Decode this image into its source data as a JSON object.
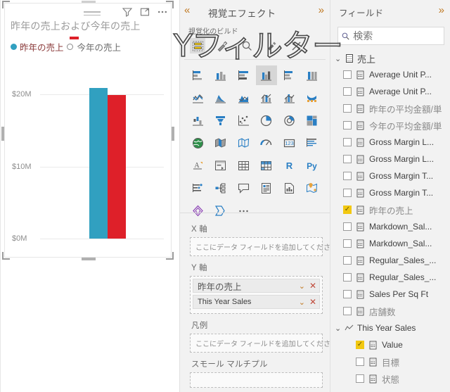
{
  "visual": {
    "title": "昨年の売上および今年の売上",
    "legend": [
      {
        "label": "昨年の売上",
        "color": "#31A0C0",
        "marker": "dot"
      },
      {
        "label": "今年の売上",
        "color": "#DE2029",
        "marker": "circle-outline"
      }
    ],
    "header_icons": [
      {
        "name": "filter-icon",
        "glyph": "filter"
      },
      {
        "name": "focus-mode-icon",
        "glyph": "focus"
      },
      {
        "name": "more-options-icon",
        "glyph": "ellipsis"
      }
    ],
    "drag_handle": "drag-handle"
  },
  "chart_data": {
    "type": "bar",
    "title": "昨年の売上および今年の売上",
    "categories": [
      ""
    ],
    "series": [
      {
        "name": "昨年の売上",
        "values": [
          20.9
        ],
        "color": "#31A0C0"
      },
      {
        "name": "今年の売上",
        "values": [
          19.9
        ],
        "color": "#DE2029"
      }
    ],
    "xlabel": "",
    "ylabel": "",
    "ylim": [
      0,
      24
    ],
    "yticks": [
      0,
      10,
      20
    ],
    "ytick_labels": [
      "$0M",
      "$10M",
      "$20M"
    ],
    "grid": true,
    "legend_position": "top"
  },
  "overlay_text": {
    "prefix": "Y",
    "text": "フィルター"
  },
  "viz_pane": {
    "title": "視覚エフェクト",
    "collapse_icon": "«",
    "expand_icon": "»",
    "build_label": "視覚化のビルド",
    "build_tabs": [
      {
        "name": "build-visual-tab",
        "icon": "fields-icon",
        "active": true
      },
      {
        "name": "format-visual-tab",
        "icon": "paint-roller-icon",
        "active": false
      },
      {
        "name": "analytics-tab",
        "icon": "magnifier-icon",
        "active": false
      },
      {
        "name": "format-page-tab",
        "icon": "paint-icon",
        "active": false
      },
      {
        "name": "extra-tab",
        "icon": "wrench-icon",
        "active": false
      }
    ],
    "viz_icons": [
      {
        "name": "stacked-bar-chart-icon",
        "selected": false
      },
      {
        "name": "stacked-column-chart-icon",
        "selected": false
      },
      {
        "name": "clustered-bar-chart-icon",
        "selected": false
      },
      {
        "name": "clustered-column-chart-icon",
        "selected": true
      },
      {
        "name": "100-stacked-bar-chart-icon",
        "selected": false
      },
      {
        "name": "100-stacked-column-chart-icon",
        "selected": false
      },
      {
        "name": "line-chart-icon",
        "selected": false
      },
      {
        "name": "area-chart-icon",
        "selected": false
      },
      {
        "name": "stacked-area-chart-icon",
        "selected": false
      },
      {
        "name": "line-stacked-column-chart-icon",
        "selected": false
      },
      {
        "name": "line-clustered-column-chart-icon",
        "selected": false
      },
      {
        "name": "ribbon-chart-icon",
        "selected": false
      },
      {
        "name": "waterfall-chart-icon",
        "selected": false
      },
      {
        "name": "funnel-chart-icon",
        "selected": false
      },
      {
        "name": "scatter-chart-icon",
        "selected": false
      },
      {
        "name": "pie-chart-icon",
        "selected": false
      },
      {
        "name": "donut-chart-icon",
        "selected": false
      },
      {
        "name": "treemap-icon",
        "selected": false
      },
      {
        "name": "map-icon",
        "selected": false
      },
      {
        "name": "filled-map-icon",
        "selected": false
      },
      {
        "name": "shape-map-icon",
        "selected": false
      },
      {
        "name": "gauge-icon",
        "selected": false
      },
      {
        "name": "card-icon",
        "selected": false
      },
      {
        "name": "multi-row-card-icon",
        "selected": false
      },
      {
        "name": "kpi-icon",
        "selected": false
      },
      {
        "name": "slicer-icon",
        "selected": false
      },
      {
        "name": "table-icon",
        "selected": false
      },
      {
        "name": "matrix-icon",
        "selected": false
      },
      {
        "name": "r-script-visual-icon",
        "selected": false
      },
      {
        "name": "python-visual-icon",
        "selected": false
      },
      {
        "name": "key-influencers-icon",
        "selected": false
      },
      {
        "name": "decomposition-tree-icon",
        "selected": false
      },
      {
        "name": "qna-icon",
        "selected": false
      },
      {
        "name": "smart-narrative-icon",
        "selected": false
      },
      {
        "name": "paginated-report-icon",
        "selected": false
      },
      {
        "name": "azure-map-icon",
        "selected": false
      },
      {
        "name": "powerapps-icon",
        "selected": false
      },
      {
        "name": "power-automate-icon",
        "selected": false
      },
      {
        "name": "more-visuals-icon",
        "selected": false
      }
    ],
    "wells": [
      {
        "name": "x-axis-well",
        "label": "X 軸",
        "placeholder": "ここにデータ フィールドを追加してください",
        "fields": []
      },
      {
        "name": "y-axis-well",
        "label": "Y 軸",
        "placeholder": "",
        "fields": [
          {
            "label": "昨年の売上",
            "japanese": true
          },
          {
            "label": "This Year Sales",
            "japanese": false
          }
        ]
      },
      {
        "name": "legend-well",
        "label": "凡例",
        "placeholder": "ここにデータ フィールドを追加してください",
        "fields": []
      },
      {
        "name": "small-multiples-well",
        "label": "スモール マルチプル",
        "placeholder": "",
        "fields": []
      }
    ]
  },
  "fields_pane": {
    "title": "フィールド",
    "expand_icon": "»",
    "search_placeholder": "検索",
    "search_value": "",
    "table": {
      "name": "売上",
      "expanded": true
    },
    "items": [
      {
        "label": "Average Unit P...",
        "checked": false,
        "japanese": false,
        "indent": "normal"
      },
      {
        "label": "Average Unit P...",
        "checked": false,
        "japanese": false,
        "indent": "normal"
      },
      {
        "label": "昨年の平均金額/単",
        "checked": false,
        "japanese": true,
        "indent": "normal"
      },
      {
        "label": "今年の平均金額/単",
        "checked": false,
        "japanese": true,
        "indent": "normal"
      },
      {
        "label": "Gross Margin L...",
        "checked": false,
        "japanese": false,
        "indent": "normal"
      },
      {
        "label": "Gross Margin L...",
        "checked": false,
        "japanese": false,
        "indent": "normal"
      },
      {
        "label": "Gross Margin T...",
        "checked": false,
        "japanese": false,
        "indent": "normal"
      },
      {
        "label": "Gross Margin T...",
        "checked": false,
        "japanese": false,
        "indent": "normal"
      },
      {
        "label": "昨年の売上",
        "checked": true,
        "japanese": true,
        "indent": "normal"
      },
      {
        "label": "Markdown_Sal...",
        "checked": false,
        "japanese": false,
        "indent": "normal"
      },
      {
        "label": "Markdown_Sal...",
        "checked": false,
        "japanese": false,
        "indent": "normal"
      },
      {
        "label": "Regular_Sales_...",
        "checked": false,
        "japanese": false,
        "indent": "normal"
      },
      {
        "label": "Regular_Sales_...",
        "checked": false,
        "japanese": false,
        "indent": "normal"
      },
      {
        "label": "Sales Per Sq Ft",
        "checked": false,
        "japanese": false,
        "indent": "normal"
      },
      {
        "label": "店舗数",
        "checked": false,
        "japanese": true,
        "indent": "normal"
      }
    ],
    "group": {
      "name": "This Year Sales",
      "expanded": true,
      "items": [
        {
          "label": "Value",
          "checked": true,
          "japanese": false
        },
        {
          "label": "目標",
          "checked": false,
          "japanese": true
        },
        {
          "label": "状態",
          "checked": false,
          "japanese": true
        }
      ]
    }
  }
}
